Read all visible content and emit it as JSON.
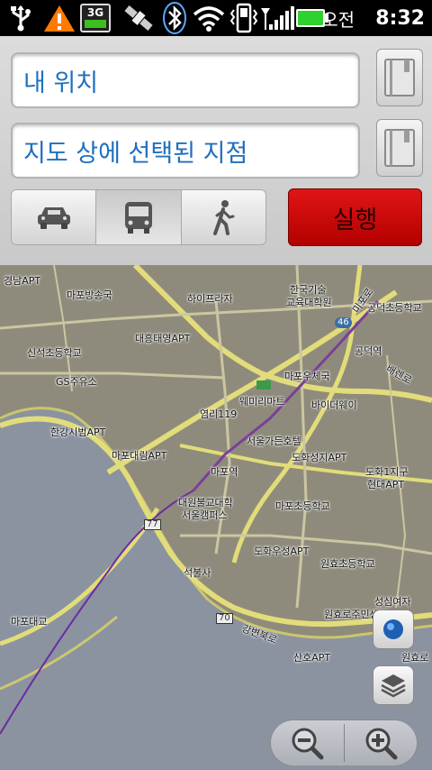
{
  "status_bar": {
    "icons": [
      "usb-icon",
      "warning-icon",
      "3g-icon",
      "gps-satellite-icon",
      "bluetooth-icon",
      "wifi-icon",
      "phone-vibrate-icon",
      "signal-icon",
      "battery-icon"
    ],
    "net_label": "3G",
    "ampm": "오전",
    "time": "8:32"
  },
  "directions": {
    "start_value": "내 위치",
    "end_value": "지도 상에 선택된 지점",
    "modes": [
      "car-icon",
      "bus-icon",
      "walk-icon"
    ],
    "selected_mode": "bus",
    "go_label": "실행",
    "go_color": "#d40f0f"
  },
  "map": {
    "labels": [
      "경남APT",
      "마포방송국",
      "하이프라자",
      "한국기술",
      "교육대학원",
      "미포로",
      "공덕초등학교",
      "46",
      "대흥태영APT",
      "신석초등학교",
      "공덕역",
      "GS주유소",
      "마포우체국",
      "배렌로",
      "웨미리마트",
      "바이더웨이",
      "염리119",
      "서울가든호텔",
      "한강시범APT",
      "도화성지APT",
      "마포대림APT",
      "마포역",
      "도화1지구",
      "현대APT",
      "대원불교대학",
      "서울캠퍼스",
      "마포초등학교",
      "77",
      "도화우성APT",
      "원효초등학교",
      "석불사",
      "성심여자",
      "원효로주민센터",
      "마포대교",
      "70",
      "강변북로",
      "산호APT",
      "원효로",
      "애마로",
      "대로"
    ]
  },
  "controls": {
    "locate_icon": "my-location-icon",
    "layers_icon": "layers-icon",
    "zoom_out_icon": "zoom-out-icon",
    "zoom_in_icon": "zoom-in-icon"
  }
}
